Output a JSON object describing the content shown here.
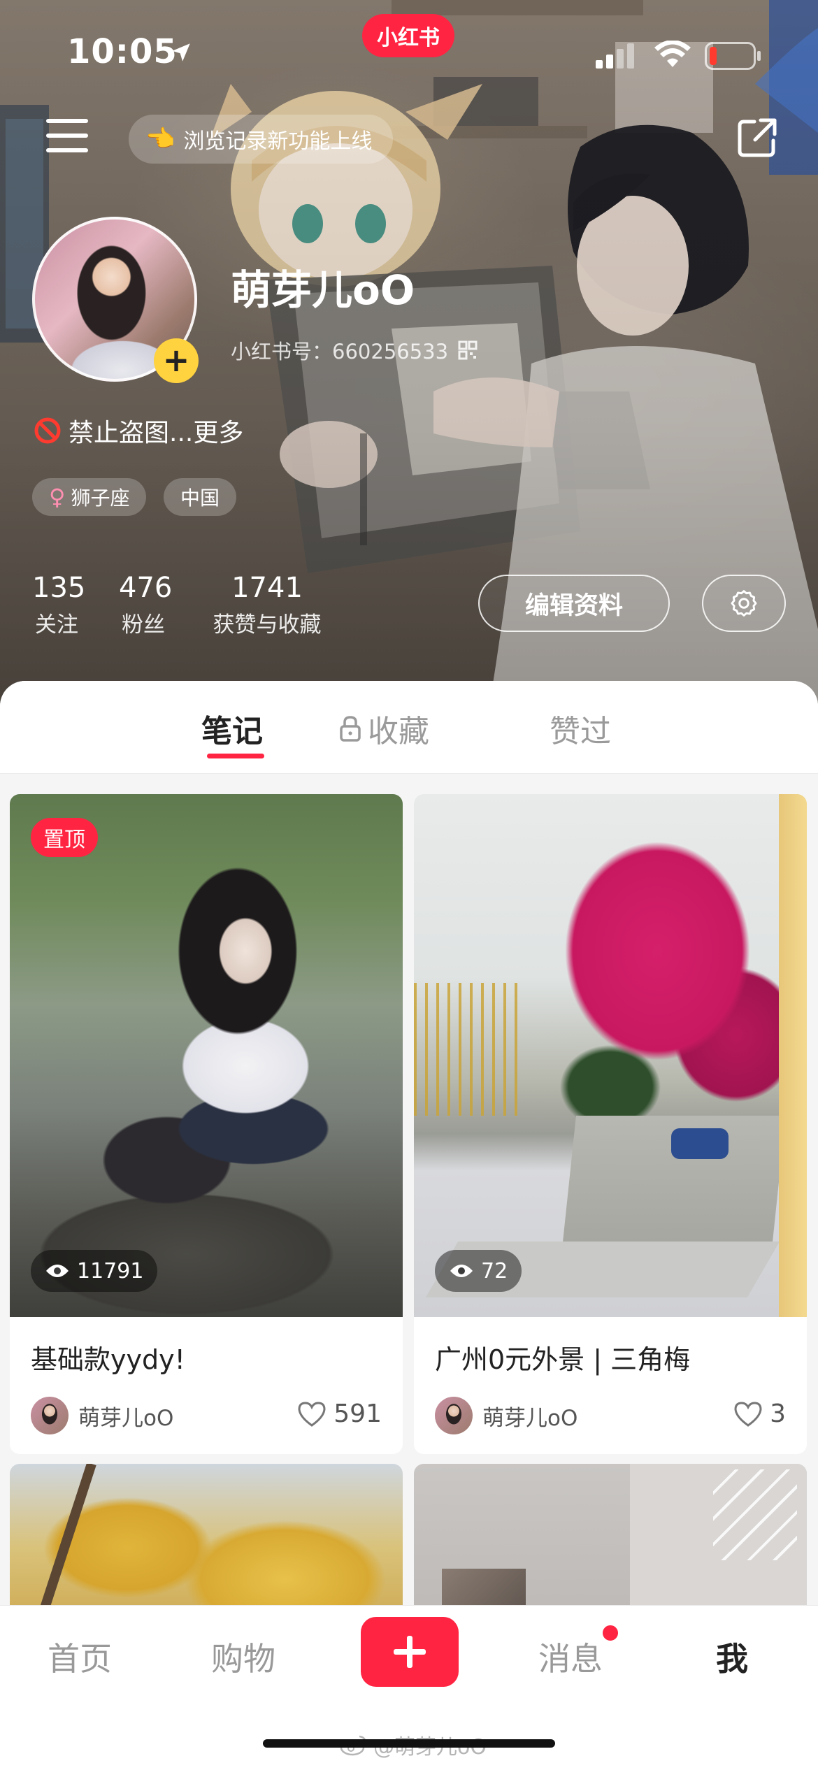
{
  "status_bar": {
    "time": "10:05",
    "app_badge": "小红书"
  },
  "header": {
    "notice_emoji": "👈",
    "notice_text": "浏览记录新功能上线",
    "nickname": "萌芽儿oO",
    "user_id_label": "小红书号：",
    "user_id_value": "660256533",
    "bio": "禁止盗图...更多",
    "tags": {
      "zodiac": "狮子座",
      "region": "中国"
    },
    "stats": {
      "follow_count": "135",
      "follow_label": "关注",
      "fans_count": "476",
      "fans_label": "粉丝",
      "likes_count": "1741",
      "likes_label": "获赞与收藏"
    },
    "edit_button": "编辑资料"
  },
  "tabs": {
    "notes": "笔记",
    "collect": "收藏",
    "liked": "赞过"
  },
  "notes": [
    {
      "pin": "置顶",
      "views": "11791",
      "title": "基础款yydy!",
      "author": "萌芽儿oO",
      "likes": "591"
    },
    {
      "views": "72",
      "title": "广州0元外景 | 三角梅",
      "author": "萌芽儿oO",
      "likes": "3"
    }
  ],
  "bottom_nav": {
    "home": "首页",
    "shop": "购物",
    "messages": "消息",
    "me": "我"
  },
  "watermark": "@萌芽儿oO",
  "colors": {
    "brand_red": "#ff2442",
    "avatar_add_yellow": "#ffd23f"
  }
}
